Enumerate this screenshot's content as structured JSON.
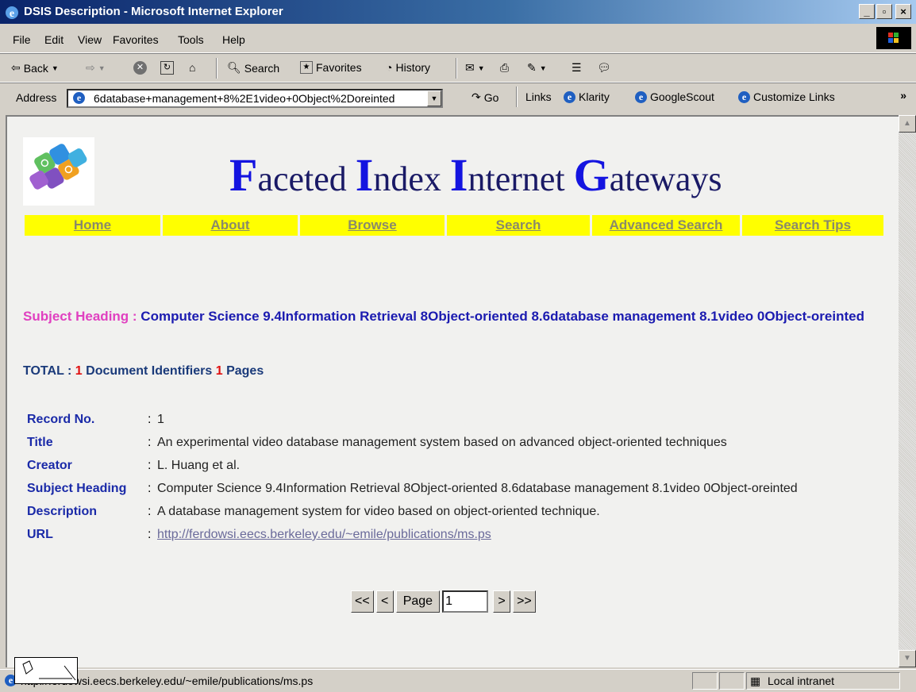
{
  "window": {
    "title": "DSIS Description - Microsoft Internet Explorer"
  },
  "menu": [
    "File",
    "Edit",
    "View",
    "Favorites",
    "Tools",
    "Help"
  ],
  "toolbar": {
    "back": "Back",
    "search": "Search",
    "favorites": "Favorites",
    "history": "History"
  },
  "addressbar": {
    "label": "Address",
    "url": "6database+management+8%2E1video+0Object%2Doreinted",
    "go": "Go",
    "links_label": "Links",
    "links": [
      "Klarity",
      "GoogleScout",
      "Customize Links"
    ]
  },
  "site": {
    "headline": [
      {
        "cap": "F",
        "rest": "aceted "
      },
      {
        "cap": "I",
        "rest": "ndex "
      },
      {
        "cap": "I",
        "rest": "nternet "
      },
      {
        "cap": "G",
        "rest": "ateways"
      }
    ],
    "nav": [
      "Home",
      "About",
      "Browse",
      "Search",
      "Advanced Search",
      "Search Tips"
    ]
  },
  "subject": {
    "label": "Subject Heading : ",
    "value": "Computer Science 9.4Information Retrieval 8Object-oriented 8.6database management 8.1video 0Object-oreinted"
  },
  "total": {
    "label": "TOTAL : ",
    "count": "1",
    "docs_label": " Document Identifiers ",
    "pages": "1",
    "pages_label": " Pages"
  },
  "record": [
    {
      "key": "Record No.",
      "value": "1"
    },
    {
      "key": "Title",
      "value": "An experimental video database management system based on advanced object-oriented techniques"
    },
    {
      "key": "Creator",
      "value": "L. Huang et al."
    },
    {
      "key": "Subject Heading",
      "value": "Computer Science 9.4Information Retrieval 8Object-oriented 8.6database management 8.1video 0Object-oreinted"
    },
    {
      "key": "Description",
      "value": "A database management system for video based on object-oriented technique."
    },
    {
      "key": "URL",
      "value": "http://ferdowsi.eecs.berkeley.edu/~emile/publications/ms.ps"
    }
  ],
  "pager": {
    "first": "<<",
    "prev": "<",
    "page_label": "Page",
    "page_value": "1",
    "next": ">",
    "last": ">>"
  },
  "status": {
    "text": "http://ferdowsi.eecs.berkeley.edu/~emile/publications/ms.ps",
    "zone": "Local intranet"
  }
}
